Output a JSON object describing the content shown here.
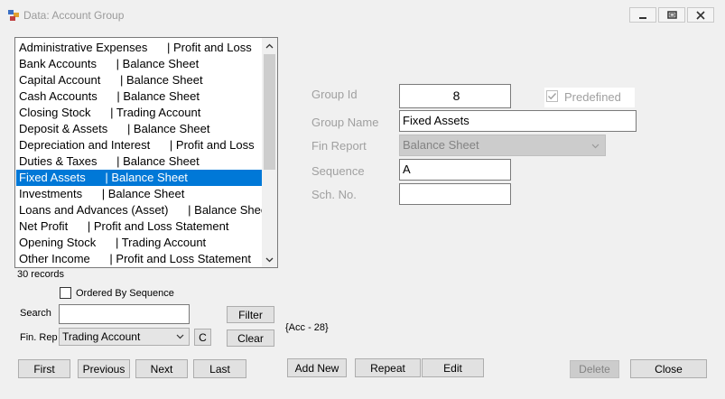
{
  "window": {
    "title": "Data: Account Group",
    "minimize_icon": "minimize-icon",
    "maximize_icon": "maximize-icon",
    "close_icon": "close-icon"
  },
  "list": {
    "items": [
      "Administrative Expenses      | Profit and Loss",
      "Bank Accounts      | Balance Sheet",
      "Capital Account      | Balance Sheet",
      "Cash Accounts      | Balance Sheet",
      "Closing Stock      | Trading Account",
      "Deposit & Assets      | Balance Sheet",
      "Depreciation and Interest      | Profit and Loss",
      "Duties & Taxes      | Balance Sheet",
      "Fixed Assets      | Balance Sheet",
      "Investments      | Balance Sheet",
      "Loans and Advances (Asset)      | Balance Sheet",
      "Net Profit      | Profit and Loss Statement",
      "Opening Stock      | Trading Account",
      "Other Income      | Profit and Loss Statement"
    ],
    "selected_index": 8,
    "record_count": "30 records"
  },
  "filters": {
    "ordered_by_sequence_label": "Ordered By Sequence",
    "ordered_by_sequence_checked": false,
    "search_label": "Search",
    "search_value": "",
    "fin_rep_label": "Fin. Rep",
    "fin_rep_value": "Trading Account",
    "c_button": "C",
    "filter_button": "Filter",
    "clear_button": "Clear"
  },
  "nav": {
    "first": "First",
    "previous": "Previous",
    "next": "Next",
    "last": "Last"
  },
  "form": {
    "group_id_label": "Group Id",
    "group_id_value": "8",
    "predefined_label": "Predefined",
    "predefined_checked": true,
    "group_name_label": "Group Name",
    "group_name_value": "Fixed Assets",
    "fin_report_label": "Fin Report",
    "fin_report_value": "Balance Sheet",
    "sequence_label": "Sequence",
    "sequence_value": "A",
    "sch_no_label": "Sch. No.",
    "sch_no_value": "",
    "acc_info": "{Acc - 28}"
  },
  "actions": {
    "add_new": "Add New",
    "repeat": "Repeat",
    "edit": "Edit",
    "delete": "Delete",
    "close": "Close"
  },
  "colors": {
    "selection": "#0078d7",
    "window_bg": "#f0f0f0",
    "disabled_text": "#a0a0a0"
  }
}
